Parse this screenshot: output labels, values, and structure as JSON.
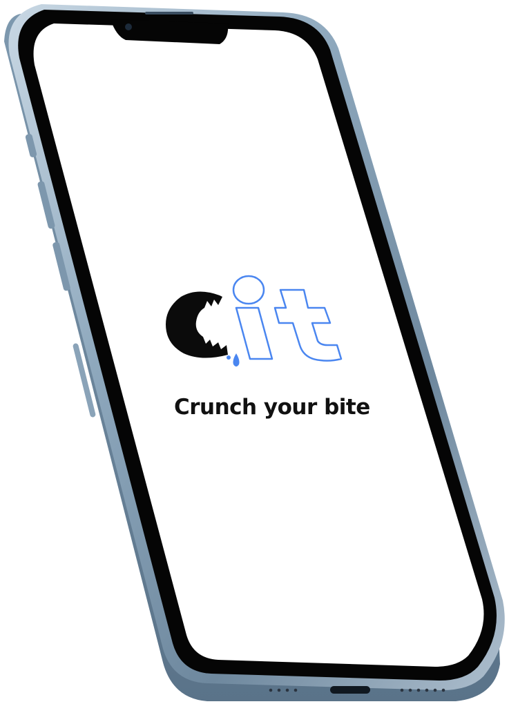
{
  "splash": {
    "logo_text": "cit",
    "tagline": "Crunch your bite"
  },
  "colors": {
    "accent": "#4a86f0",
    "logo_dark": "#0b0b0b",
    "frame_blue": "#8aa4bb",
    "bezel": "#050505",
    "screen_bg": "#ffffff"
  }
}
